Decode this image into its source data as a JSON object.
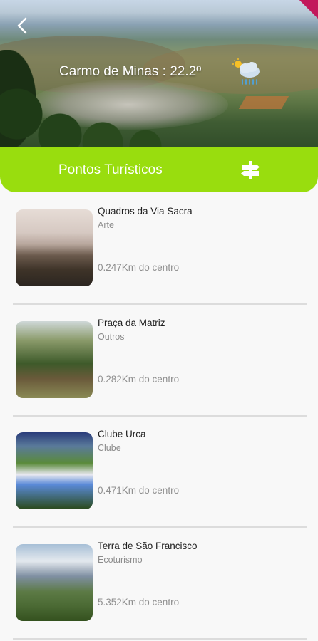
{
  "header": {
    "weather_title": "Carmo de Minas : 22.2º",
    "weather_icon": "partly-sunny-rain-icon",
    "back_icon": "chevron-left-icon"
  },
  "banner": {
    "title": "Pontos Turísticos",
    "icon": "signpost-icon",
    "color": "#99dd0e"
  },
  "places": [
    {
      "name": "Quadros da Via Sacra",
      "category": "Arte",
      "distance": "0.247Km do centro"
    },
    {
      "name": "Praça da Matriz",
      "category": "Outros",
      "distance": "0.282Km do centro"
    },
    {
      "name": "Clube Urca",
      "category": "Clube",
      "distance": "0.471Km do centro"
    },
    {
      "name": "Terra de São Francisco",
      "category": "Ecoturismo",
      "distance": "5.352Km do centro"
    }
  ]
}
